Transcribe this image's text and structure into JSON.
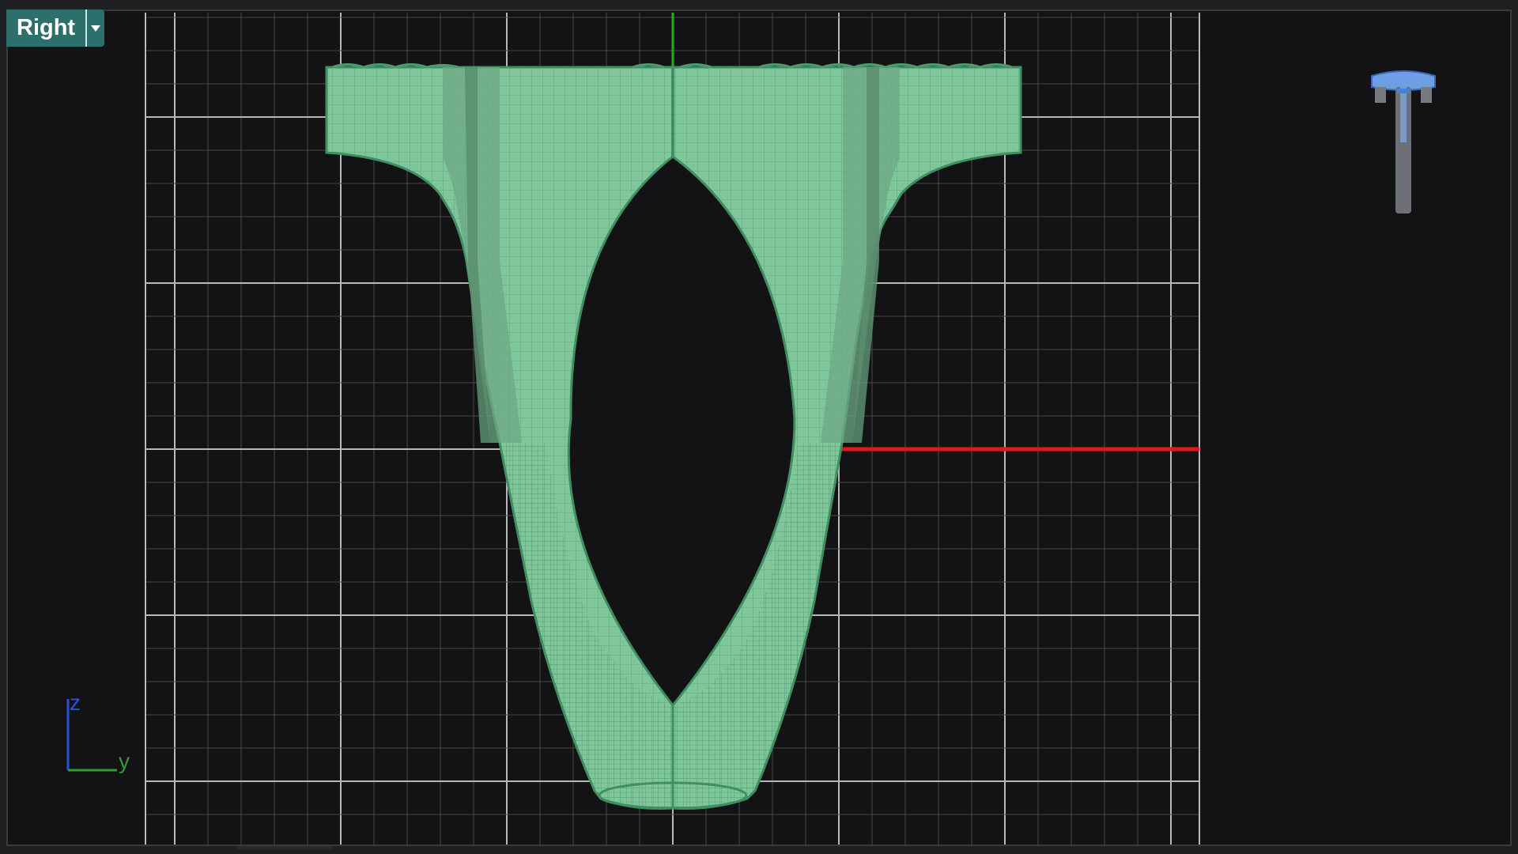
{
  "viewport": {
    "name": "Right",
    "dropdown_icon": "chevron-down-icon"
  },
  "axis_widget": {
    "z_label": "z",
    "y_label": "y",
    "colors": {
      "z": "#2b4fd8",
      "y": "#2f9a3a"
    }
  },
  "colors": {
    "background": "#131316",
    "grid_minor": "#4a4a4e",
    "grid_major": "#b8b8bc",
    "world_x_axis": "#e01818",
    "world_z_axis": "#1fb21f",
    "model_fill": "#7fc79a",
    "model_edge": "#3f8f63",
    "tab": "#2d6f6c"
  },
  "navigation_cube": {
    "icon": "ring-preview-icon"
  }
}
